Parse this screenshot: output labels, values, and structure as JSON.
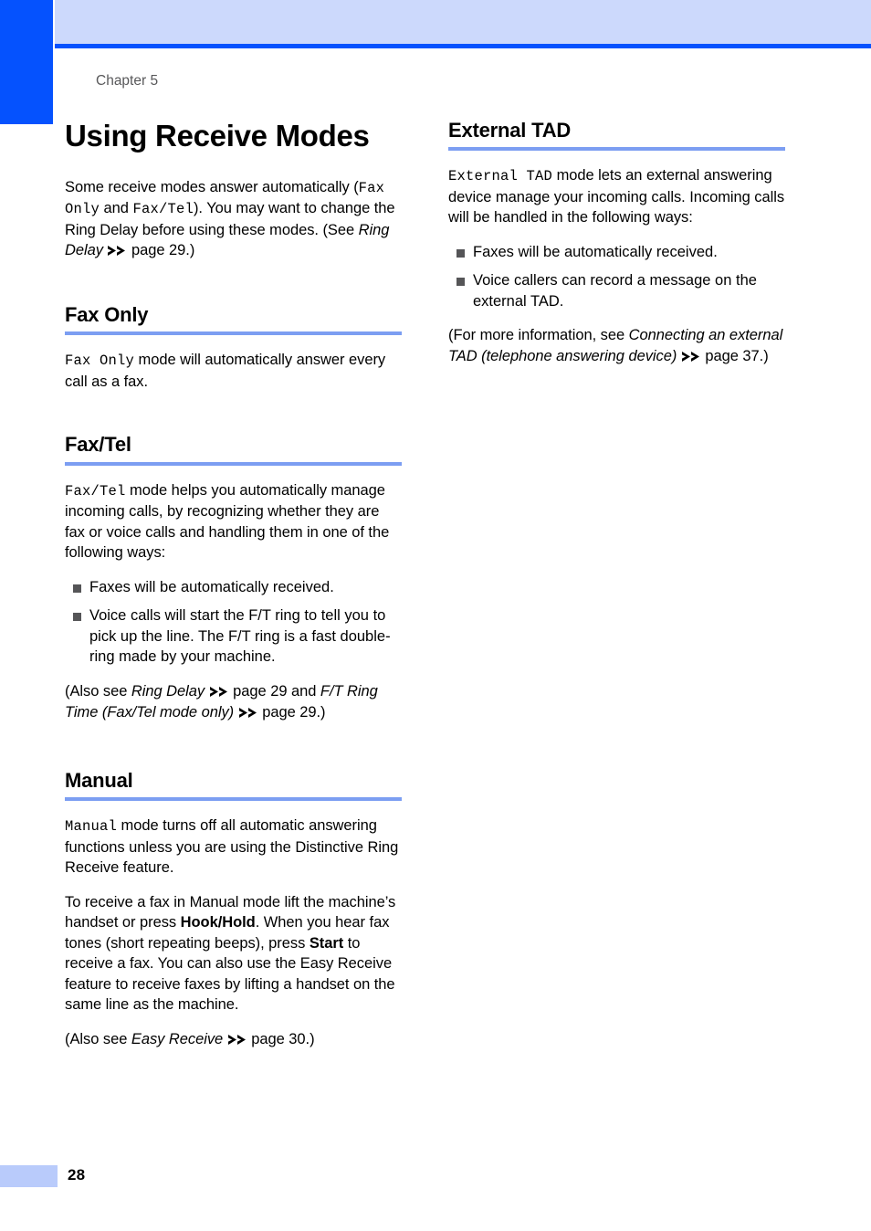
{
  "page": {
    "chapter_label": "Chapter 5",
    "page_number": "28",
    "colors": {
      "tab_blue": "#0552fe",
      "band_blue": "#ccd9fc",
      "rule_blue": "#7c9ef2",
      "footer_blue": "#b9cbfb",
      "bullet_gray": "#555557",
      "chapter_text_gray": "#58585a"
    }
  },
  "left_column": {
    "title": "Using Receive Modes",
    "intro": {
      "p1_a": "Some receive modes answer automatically (",
      "p1_code1": "Fax Only",
      "p1_b": " and ",
      "p1_code2": "Fax/Tel",
      "p1_c": "). You may want to change the Ring Delay before using these modes. (See ",
      "p1_ref": "Ring Delay",
      "p1_d": " page 29.)"
    },
    "sections": [
      {
        "heading": "Fax Only",
        "p1_code": "Fax Only",
        "p1_text": " mode will automatically answer every call as a fax."
      },
      {
        "heading": "Fax/Tel",
        "p1_code": "Fax/Tel",
        "p1_text": " mode helps you automatically manage incoming calls, by recognizing whether they are fax or voice calls and handling them in one of the following ways:",
        "bullets": [
          "Faxes will be automatically received.",
          "Voice calls will start the F/T ring to tell you to pick up the line. The F/T ring is a fast double-ring made by your machine."
        ],
        "note_a": "(Also see ",
        "note_ref1": "Ring Delay",
        "note_b": " page 29 and ",
        "note_ref2": "F/T Ring Time (Fax/Tel mode only)",
        "note_c": " page 29.)"
      },
      {
        "heading": "Manual",
        "p1_code": "Manual",
        "p1_text": " mode turns off all automatic answering functions unless you are using the Distinctive Ring Receive feature.",
        "p2_a": "To receive a fax in Manual mode lift the machine’s handset or press ",
        "p2_bold1": "Hook/Hold",
        "p2_b": ". When you hear fax tones (short repeating beeps), press ",
        "p2_bold2": "Start",
        "p2_c": " to receive a fax. You can also use the Easy Receive feature to receive faxes by lifting a handset on the same line as the machine.",
        "note_a": "(Also see ",
        "note_ref1": "Easy Receive",
        "note_b": " page 30.)"
      }
    ]
  },
  "right_column": {
    "sections": [
      {
        "heading": "External TAD",
        "p1_code": "External TAD",
        "p1_text": " mode lets an external answering device manage your incoming calls. Incoming calls will be handled in the following ways:",
        "bullets": [
          "Faxes will be automatically received.",
          "Voice callers can record a message on the external TAD."
        ],
        "note_a": "(For more information, see ",
        "note_ref1": "Connecting an external TAD (telephone answering device)",
        "note_b": " page 37.)"
      }
    ]
  }
}
